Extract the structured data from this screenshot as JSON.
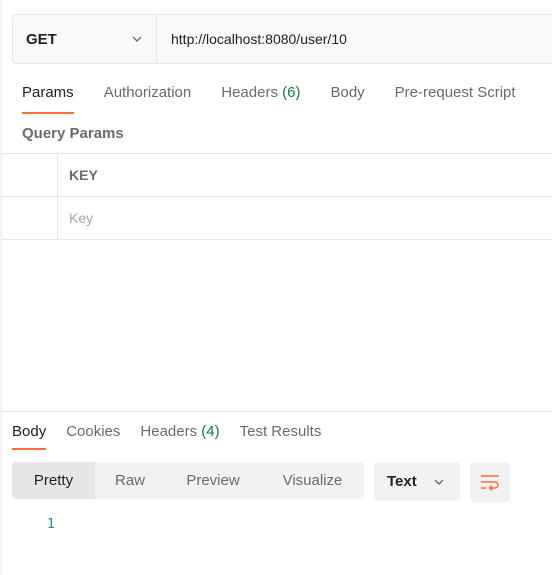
{
  "request": {
    "method": "GET",
    "url": "http://localhost:8080/user/10"
  },
  "request_tabs": [
    {
      "label": "Params",
      "active": true
    },
    {
      "label": "Authorization"
    },
    {
      "label": "Headers",
      "count": "(6)"
    },
    {
      "label": "Body"
    },
    {
      "label": "Pre-request Script"
    }
  ],
  "query_params": {
    "title": "Query Params",
    "key_header": "KEY",
    "key_placeholder": "Key"
  },
  "response_tabs": [
    {
      "label": "Body",
      "active": true
    },
    {
      "label": "Cookies"
    },
    {
      "label": "Headers",
      "count": "(4)"
    },
    {
      "label": "Test Results"
    }
  ],
  "response_views": [
    "Pretty",
    "Raw",
    "Preview",
    "Visualize"
  ],
  "response_format": "Text",
  "response_lines": [
    "1"
  ],
  "colors": {
    "accent": "#ff6c37",
    "count": "#0f7b3e",
    "line_number": "#2b8a8a"
  },
  "icons": {
    "method_dropdown": "chevron-down-icon",
    "format_dropdown": "chevron-down-icon",
    "wrap": "wrap-lines-icon"
  }
}
